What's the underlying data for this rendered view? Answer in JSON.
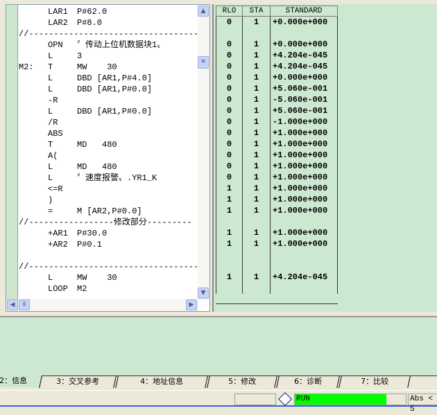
{
  "code_lines": [
    {
      "label": "",
      "op": "LAR1",
      "arg": "P#62.0",
      "rlo": "",
      "sta": "",
      "std": ""
    },
    {
      "label": "",
      "op": "LAR2",
      "arg": "P#8.0",
      "rlo": "0",
      "sta": "1",
      "std": "+0.000e+000"
    },
    {
      "comment": "//--------------------------------------"
    },
    {
      "label": "",
      "op": "OPN",
      "arg": "〞传动上位机数据块1〟",
      "rlo": "0",
      "sta": "1",
      "std": "+0.000e+000"
    },
    {
      "label": "",
      "op": "L",
      "arg": "3",
      "rlo": "0",
      "sta": "1",
      "std": "+4.204e-045"
    },
    {
      "label": "M2:",
      "op": "T",
      "arg": "MW    30",
      "rlo": "0",
      "sta": "1",
      "std": "+4.204e-045"
    },
    {
      "label": "",
      "op": "L",
      "arg": "DBD [AR1,P#4.0]",
      "rlo": "0",
      "sta": "1",
      "std": "+0.000e+000"
    },
    {
      "label": "",
      "op": "L",
      "arg": "DBD [AR1,P#0.0]",
      "rlo": "0",
      "sta": "1",
      "std": "+5.060e-001"
    },
    {
      "label": "",
      "op": "-R",
      "arg": "",
      "rlo": "0",
      "sta": "1",
      "std": "-5.060e-001"
    },
    {
      "label": "",
      "op": "L",
      "arg": "DBD [AR1,P#0.0]",
      "rlo": "0",
      "sta": "1",
      "std": "+5.060e-001"
    },
    {
      "label": "",
      "op": "/R",
      "arg": "",
      "rlo": "0",
      "sta": "1",
      "std": "-1.000e+000"
    },
    {
      "label": "",
      "op": "ABS",
      "arg": "",
      "rlo": "0",
      "sta": "1",
      "std": "+1.000e+000"
    },
    {
      "label": "",
      "op": "T",
      "arg": "MD   480",
      "rlo": "0",
      "sta": "1",
      "std": "+1.000e+000"
    },
    {
      "label": "",
      "op": "A(",
      "arg": "",
      "rlo": "0",
      "sta": "1",
      "std": "+1.000e+000"
    },
    {
      "label": "",
      "op": "L",
      "arg": "MD   480",
      "rlo": "0",
      "sta": "1",
      "std": "+1.000e+000"
    },
    {
      "label": "",
      "op": "L",
      "arg": "〞速度报警〟.YR1_K",
      "rlo": "0",
      "sta": "1",
      "std": "+1.000e+000"
    },
    {
      "label": "",
      "op": "<=R",
      "arg": "",
      "rlo": "1",
      "sta": "1",
      "std": "+1.000e+000"
    },
    {
      "label": "",
      "op": ")",
      "arg": "",
      "rlo": "1",
      "sta": "1",
      "std": "+1.000e+000"
    },
    {
      "label": "",
      "op": "=",
      "arg": "M [AR2,P#0.0]",
      "rlo": "1",
      "sta": "1",
      "std": "+1.000e+000"
    },
    {
      "comment": "//-----------------修改部分---------"
    },
    {
      "label": "",
      "op": "+AR1",
      "arg": "P#30.0",
      "rlo": "1",
      "sta": "1",
      "std": "+1.000e+000"
    },
    {
      "label": "",
      "op": "+AR2",
      "arg": "P#0.1",
      "rlo": "1",
      "sta": "1",
      "std": "+1.000e+000"
    },
    {
      "label": "",
      "op": "",
      "arg": "",
      "rlo": "",
      "sta": "",
      "std": ""
    },
    {
      "comment": "//--------------------------------------"
    },
    {
      "label": "",
      "op": "L",
      "arg": "MW    30",
      "rlo": "1",
      "sta": "1",
      "std": "+4.204e-045"
    },
    {
      "label": "",
      "op": "LOOP",
      "arg": "M2",
      "rlo": "",
      "sta": "",
      "std": ""
    }
  ],
  "status_table": {
    "headers": [
      "RLO",
      "STA",
      "STANDARD"
    ]
  },
  "tabs": [
    "2：信息",
    "3：交叉参考",
    "4：地址信息",
    "5：修改",
    "6：诊断",
    "7：比较"
  ],
  "status_bar": {
    "mode": "RUN",
    "abs": "Abs < 5"
  },
  "colors": {
    "pane_bg": "#cde8d0",
    "run": "#00ff00"
  }
}
